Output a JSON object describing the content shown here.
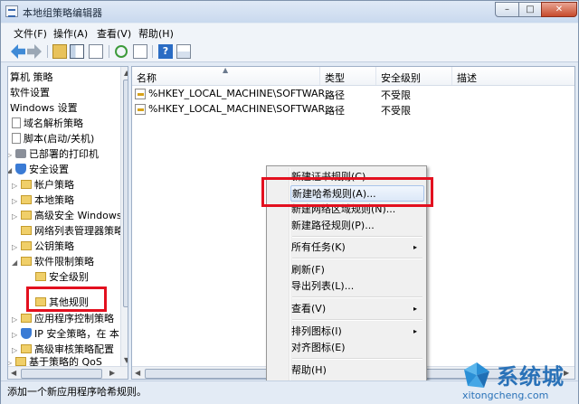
{
  "window": {
    "title": "本地组策略编辑器",
    "controls": {
      "minimize": "–",
      "maximize": "□",
      "close": "✕"
    }
  },
  "menubar": [
    "文件(F)",
    "操作(A)",
    "查看(V)",
    "帮助(H)"
  ],
  "toolbar": [
    "back-arrow-icon",
    "forward-arrow-icon",
    "up-folder-icon",
    "show-tree-icon",
    "properties-doc-icon",
    "refresh-icon",
    "export-list-icon",
    "help-icon",
    "console-props-icon"
  ],
  "tree": {
    "items": [
      {
        "label": "算机 策略",
        "icon": "none"
      },
      {
        "label": "软件设置",
        "icon": "none"
      },
      {
        "label": "Windows 设置",
        "icon": "none"
      },
      {
        "label": "域名解析策略",
        "icon": "script"
      },
      {
        "label": "脚本(启动/关机)",
        "icon": "script"
      },
      {
        "label": "已部署的打印机",
        "icon": "printer"
      },
      {
        "label": "安全设置",
        "icon": "shield"
      },
      {
        "label": "帐户策略",
        "icon": "folder"
      },
      {
        "label": "本地策略",
        "icon": "folder"
      },
      {
        "label": "高级安全 Windows",
        "icon": "folder"
      },
      {
        "label": "网络列表管理器策略",
        "icon": "folder"
      },
      {
        "label": "公钥策略",
        "icon": "folder"
      },
      {
        "label": "软件限制策略",
        "icon": "folder"
      },
      {
        "label": "安全级别",
        "icon": "folder"
      },
      {
        "label": "其他规则",
        "icon": "folder"
      },
      {
        "label": "应用程序控制策略",
        "icon": "folder"
      },
      {
        "label": "IP 安全策略，在 本",
        "icon": "shield"
      },
      {
        "label": "高级审核策略配置",
        "icon": "folder"
      },
      {
        "label": "基于策略的 QoS",
        "icon": "folder"
      }
    ]
  },
  "list": {
    "columns": [
      "名称",
      "类型",
      "安全级别",
      "描述"
    ],
    "rows": [
      {
        "name": "%HKEY_LOCAL_MACHINE\\SOFTWAR...",
        "type": "路径",
        "level": "不受限",
        "desc": ""
      },
      {
        "name": "%HKEY_LOCAL_MACHINE\\SOFTWAR...",
        "type": "路径",
        "level": "不受限",
        "desc": ""
      }
    ]
  },
  "context_menu": {
    "items": [
      {
        "label": "新建证书规则(C)...",
        "submenu": false
      },
      {
        "label": "新建哈希规则(A)...",
        "submenu": false,
        "highlighted": true
      },
      {
        "label": "新建网络区域规则(N)...",
        "submenu": false
      },
      {
        "label": "新建路径规则(P)...",
        "submenu": false
      },
      {
        "label": "所有任务(K)",
        "submenu": true
      },
      {
        "label": "刷新(F)",
        "submenu": false
      },
      {
        "label": "导出列表(L)...",
        "submenu": false
      },
      {
        "label": "查看(V)",
        "submenu": true
      },
      {
        "label": "排列图标(I)",
        "submenu": true
      },
      {
        "label": "对齐图标(E)",
        "submenu": false
      },
      {
        "label": "帮助(H)",
        "submenu": false
      }
    ],
    "submenu_glyph": "▸"
  },
  "status": {
    "text": "添加一个新应用程序哈希规则。"
  },
  "watermark": {
    "text": "系统城",
    "subtext": "xitongcheng.com"
  },
  "colors": {
    "highlight_box": "#e3101f",
    "watermark": "#2a72b8"
  }
}
